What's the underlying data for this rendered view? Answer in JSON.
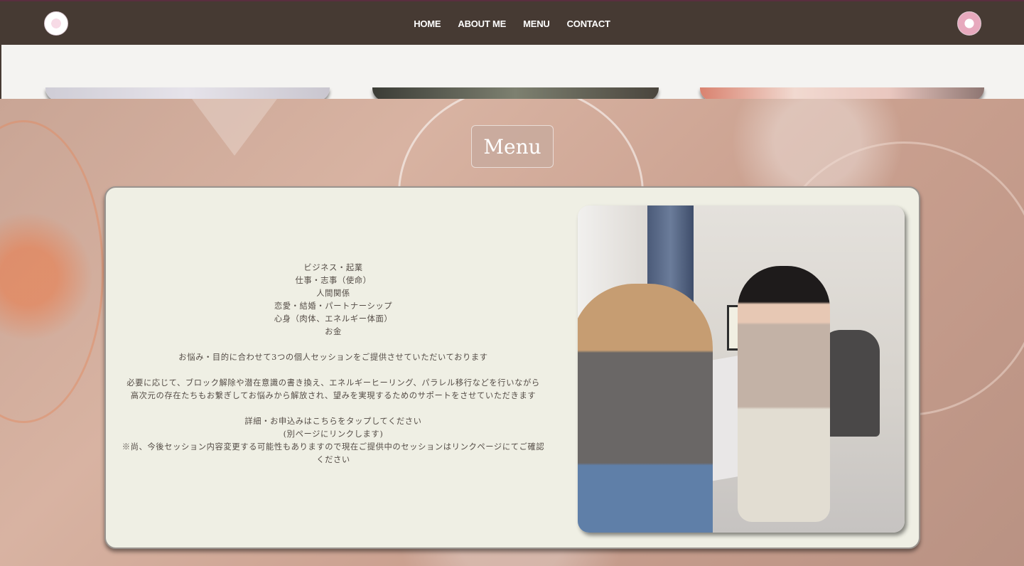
{
  "nav": {
    "items": [
      {
        "label": "HOME"
      },
      {
        "label": "ABOUT ME"
      },
      {
        "label": "MENU"
      },
      {
        "label": "CONTACT"
      }
    ]
  },
  "menu": {
    "title": "Menu",
    "lines": [
      "ビジネス・起業",
      "仕事・志事（使命）",
      "人間関係",
      "恋愛・結婚・パートナーシップ",
      "心身（肉体、エネルギー体面）",
      "お金",
      "",
      "お悩み・目的に合わせて3つの個人セッションをご提供させていただいております",
      "",
      "必要に応じて、ブロック解除や潜在意識の書き換え、エネルギーヒーリング、パラレル移行などを行いながら",
      "高次元の存在たちもお繋ぎしてお悩みから解放され、望みを実現するためのサポートをさせていただきます",
      "",
      "詳細・お申込みはこちらをタップしてください",
      "(別ページにリンクします)",
      "※尚、今後セッション内容変更する可能性もありますので現在ご提供中のセッションはリンクページにてご確認ください"
    ]
  },
  "colors": {
    "header_bg": "#463a33",
    "card_bg": "#efefe4",
    "text": "#544c46"
  }
}
